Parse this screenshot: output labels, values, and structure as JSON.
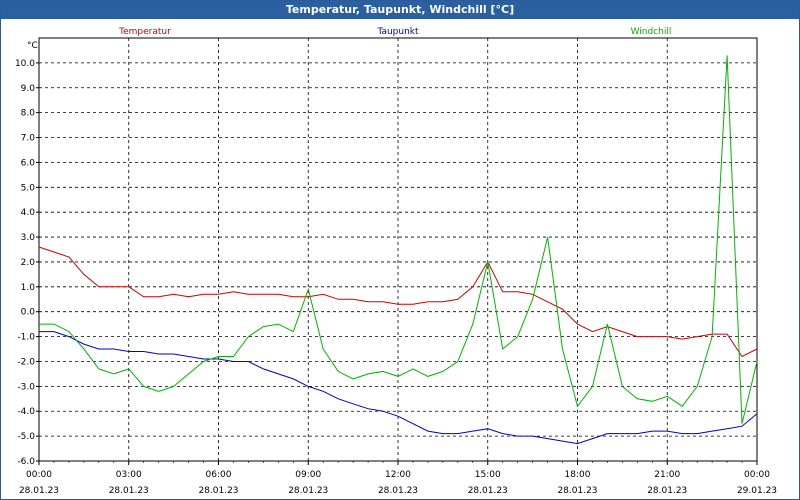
{
  "window": {
    "title": "Temperatur, Taupunkt, Windchill [°C]"
  },
  "chart_data": {
    "type": "line",
    "ylabel": "°C",
    "ylim": [
      -6.0,
      11.0
    ],
    "yticks": [
      "10.0",
      "9.0",
      "8.0",
      "7.0",
      "6.0",
      "5.0",
      "4.0",
      "3.0",
      "2.0",
      "1.0",
      "0.0",
      "-1.0",
      "-2.0",
      "-3.0",
      "-4.0",
      "-5.0",
      "-6.0"
    ],
    "xlim": [
      0,
      24
    ],
    "xticks": [
      {
        "time": "00:00",
        "date": "28.01.23"
      },
      {
        "time": "03:00",
        "date": "28.01.23"
      },
      {
        "time": "06:00",
        "date": "28.01.23"
      },
      {
        "time": "09:00",
        "date": "28.01.23"
      },
      {
        "time": "12:00",
        "date": "28.01.23"
      },
      {
        "time": "15:00",
        "date": "28.01.23"
      },
      {
        "time": "18:00",
        "date": "28.01.23"
      },
      {
        "time": "21:00",
        "date": "28.01.23"
      },
      {
        "time": "00:00",
        "date": "29.01.23"
      }
    ],
    "grid": true,
    "series": [
      {
        "name": "Temperatur",
        "color": "#cc0000",
        "x": [
          0,
          0.5,
          1,
          1.5,
          2,
          2.5,
          3,
          3.5,
          4,
          4.5,
          5,
          5.5,
          6,
          6.5,
          7,
          7.5,
          8,
          8.5,
          9,
          9.5,
          10,
          10.5,
          11,
          11.5,
          12,
          12.5,
          13,
          13.5,
          14,
          14.5,
          15,
          15.5,
          16,
          16.5,
          17,
          17.5,
          18,
          18.5,
          19,
          19.5,
          20,
          20.5,
          21,
          21.5,
          22,
          22.5,
          23,
          23.5,
          24
        ],
        "values": [
          2.6,
          2.4,
          2.2,
          1.5,
          1.0,
          1.0,
          1.0,
          0.6,
          0.6,
          0.7,
          0.6,
          0.7,
          0.7,
          0.8,
          0.7,
          0.7,
          0.7,
          0.6,
          0.6,
          0.7,
          0.5,
          0.5,
          0.4,
          0.4,
          0.3,
          0.3,
          0.4,
          0.4,
          0.5,
          1.0,
          2.0,
          0.8,
          0.8,
          0.7,
          0.4,
          0.1,
          -0.5,
          -0.8,
          -0.6,
          -0.8,
          -1.0,
          -1.0,
          -1.0,
          -1.1,
          -1.0,
          -0.9,
          -0.9,
          -1.8,
          -1.5
        ]
      },
      {
        "name": "Taupunkt",
        "color": "#0000cc",
        "x": [
          0,
          0.5,
          1,
          1.5,
          2,
          2.5,
          3,
          3.5,
          4,
          4.5,
          5,
          5.5,
          6,
          6.5,
          7,
          7.5,
          8,
          8.5,
          9,
          9.5,
          10,
          10.5,
          11,
          11.5,
          12,
          12.5,
          13,
          13.5,
          14,
          14.5,
          15,
          15.5,
          16,
          16.5,
          17,
          17.5,
          18,
          18.5,
          19,
          19.5,
          20,
          20.5,
          21,
          21.5,
          22,
          22.5,
          23,
          23.5,
          24
        ],
        "values": [
          -0.8,
          -0.8,
          -1.0,
          -1.3,
          -1.5,
          -1.5,
          -1.6,
          -1.6,
          -1.7,
          -1.7,
          -1.8,
          -1.9,
          -1.9,
          -2.0,
          -2.0,
          -2.3,
          -2.5,
          -2.7,
          -3.0,
          -3.2,
          -3.5,
          -3.7,
          -3.9,
          -4.0,
          -4.2,
          -4.5,
          -4.8,
          -4.9,
          -4.9,
          -4.8,
          -4.7,
          -4.9,
          -5.0,
          -5.0,
          -5.1,
          -5.2,
          -5.3,
          -5.1,
          -4.9,
          -4.9,
          -4.9,
          -4.8,
          -4.8,
          -4.9,
          -4.9,
          -4.8,
          -4.7,
          -4.6,
          -4.1
        ]
      },
      {
        "name": "Windchill",
        "color": "#00b400",
        "x": [
          0,
          0.5,
          1,
          1.5,
          2,
          2.5,
          3,
          3.5,
          4,
          4.5,
          5,
          5.5,
          6,
          6.5,
          7,
          7.5,
          8,
          8.5,
          9,
          9.5,
          10,
          10.5,
          11,
          11.5,
          12,
          12.5,
          13,
          13.5,
          14,
          14.5,
          15,
          15.5,
          16,
          16.5,
          17,
          17.5,
          18,
          18.5,
          19,
          19.5,
          20,
          20.5,
          21,
          21.5,
          22,
          22.5,
          23,
          23.5,
          24
        ],
        "values": [
          -0.5,
          -0.5,
          -0.8,
          -1.5,
          -2.3,
          -2.5,
          -2.3,
          -3.0,
          -3.2,
          -3.0,
          -2.5,
          -2.0,
          -1.8,
          -1.8,
          -1.0,
          -0.6,
          -0.5,
          -0.8,
          0.9,
          -1.5,
          -2.4,
          -2.7,
          -2.5,
          -2.4,
          -2.6,
          -2.3,
          -2.6,
          -2.4,
          -2.0,
          -0.5,
          2.0,
          -1.5,
          -1.0,
          0.5,
          3.0,
          -1.5,
          -3.8,
          -3.0,
          -0.5,
          -3.0,
          -3.5,
          -3.6,
          -3.4,
          -3.8,
          -3.0,
          -1.0,
          10.3,
          -4.5,
          -2.0
        ]
      }
    ]
  }
}
